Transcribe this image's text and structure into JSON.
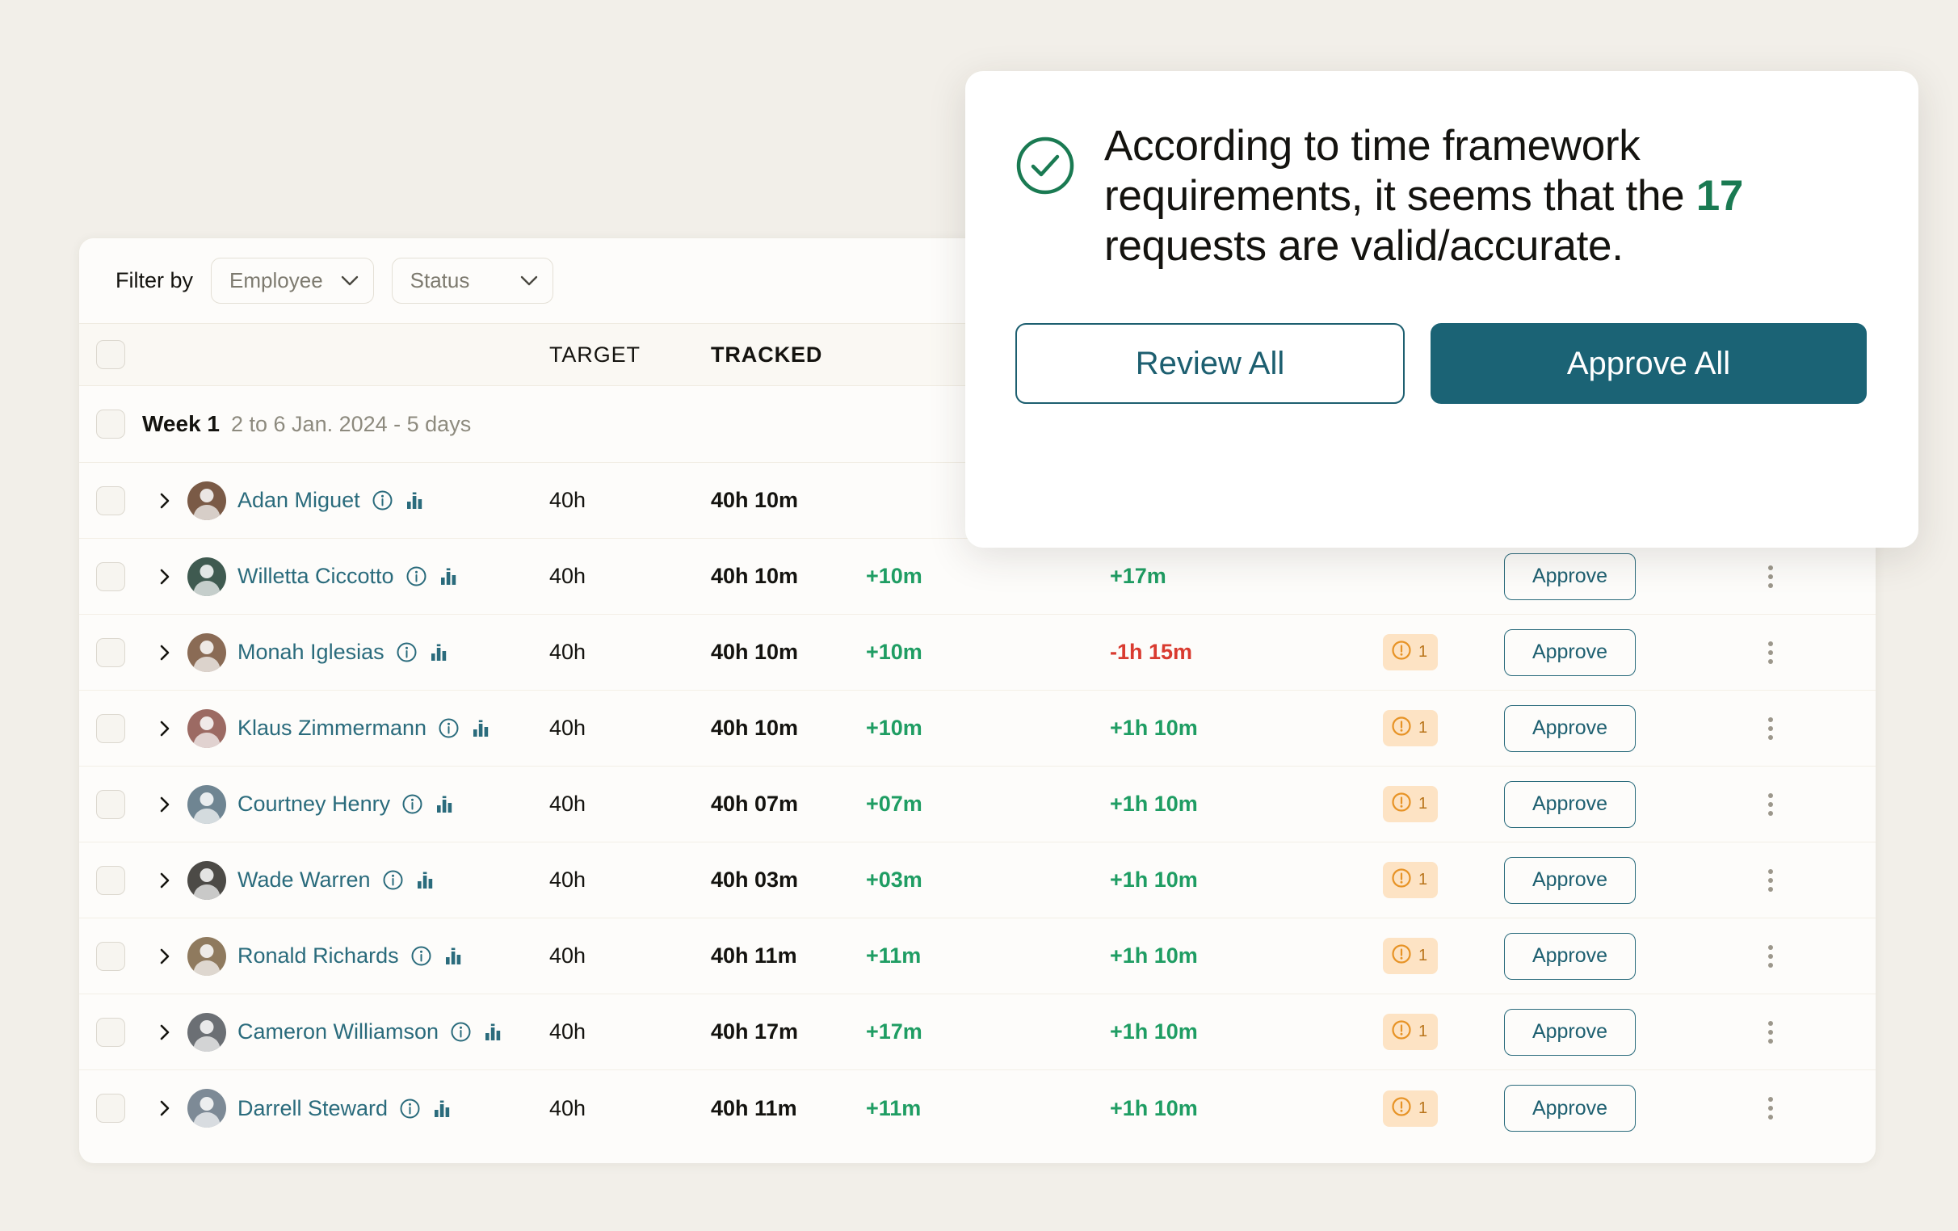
{
  "colors": {
    "page_bg": "#f2efe9",
    "card_bg": "#fdfcfa",
    "teal": "#1b6375",
    "link_teal": "#2a6b7c",
    "green": "#1f9d63",
    "green_dark": "#1a7a52",
    "red": "#d93b30",
    "badge_bg": "#fde3c4",
    "badge_fg": "#b9741a"
  },
  "filter": {
    "label": "Filter by",
    "employee_select": {
      "value": "Employee",
      "icon": "chevron-down-icon"
    },
    "status_select": {
      "value": "Status",
      "icon": "chevron-down-icon"
    }
  },
  "table": {
    "headers": {
      "target": "TARGET",
      "tracked": "TRACKED"
    },
    "week_group": {
      "title": "Week 1",
      "subtitle": "2 to 6 Jan. 2024 - 5 days"
    },
    "approve_label": "Approve",
    "rows": [
      {
        "name": "Adan Miguet",
        "target": "40h",
        "tracked": "40h 10m",
        "diff": "",
        "balance": "",
        "diff_sign": "pos",
        "balance_sign": "pos",
        "badge": "",
        "hidden_by_modal": true
      },
      {
        "name": "Willetta Ciccotto",
        "target": "40h",
        "tracked": "40h 10m",
        "diff": "+10m",
        "balance": "+17m",
        "diff_sign": "pos",
        "balance_sign": "pos",
        "badge": "",
        "hidden_by_modal": false
      },
      {
        "name": "Monah Iglesias",
        "target": "40h",
        "tracked": "40h 10m",
        "diff": "+10m",
        "balance": "-1h 15m",
        "diff_sign": "pos",
        "balance_sign": "neg",
        "badge": "1",
        "hidden_by_modal": false
      },
      {
        "name": "Klaus Zimmermann",
        "target": "40h",
        "tracked": "40h 10m",
        "diff": "+10m",
        "balance": "+1h 10m",
        "diff_sign": "pos",
        "balance_sign": "pos",
        "badge": "1",
        "hidden_by_modal": false
      },
      {
        "name": "Courtney Henry",
        "target": "40h",
        "tracked": "40h 07m",
        "diff": "+07m",
        "balance": "+1h 10m",
        "diff_sign": "pos",
        "balance_sign": "pos",
        "badge": "1",
        "hidden_by_modal": false
      },
      {
        "name": "Wade Warren",
        "target": "40h",
        "tracked": "40h 03m",
        "diff": "+03m",
        "balance": "+1h 10m",
        "diff_sign": "pos",
        "balance_sign": "pos",
        "badge": "1",
        "hidden_by_modal": false
      },
      {
        "name": "Ronald Richards",
        "target": "40h",
        "tracked": "40h 11m",
        "diff": "+11m",
        "balance": "+1h 10m",
        "diff_sign": "pos",
        "balance_sign": "pos",
        "badge": "1",
        "hidden_by_modal": false
      },
      {
        "name": "Cameron Williamson",
        "target": "40h",
        "tracked": "40h 17m",
        "diff": "+17m",
        "balance": "+1h 10m",
        "diff_sign": "pos",
        "balance_sign": "pos",
        "badge": "1",
        "hidden_by_modal": false
      },
      {
        "name": "Darrell Steward",
        "target": "40h",
        "tracked": "40h 11m",
        "diff": "+11m",
        "balance": "+1h 10m",
        "diff_sign": "pos",
        "balance_sign": "pos",
        "badge": "1",
        "hidden_by_modal": false
      }
    ]
  },
  "modal": {
    "icon": "check-circle-icon",
    "text_before": "According to time framework requirements, it seems that the ",
    "highlight": "17",
    "text_after": " requests are valid/accurate.",
    "review_label": "Review All",
    "approve_label": "Approve All"
  }
}
